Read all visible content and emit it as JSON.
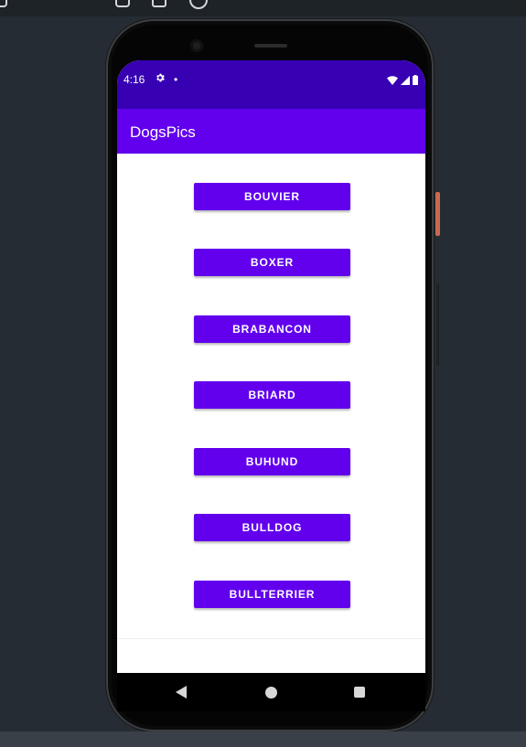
{
  "status_bar": {
    "time": "4:16",
    "settings_icon": "gear-icon",
    "notification_dot": "•",
    "wifi_icon": "wifi-icon",
    "signal_icon": "signal-icon",
    "battery_icon": "battery-icon"
  },
  "app_bar": {
    "title": "DogsPics"
  },
  "breeds": [
    {
      "label": "BOUVIER"
    },
    {
      "label": "BOXER"
    },
    {
      "label": "BRABANCON"
    },
    {
      "label": "BRIARD"
    },
    {
      "label": "BUHUND"
    },
    {
      "label": "BULLDOG"
    },
    {
      "label": "BULLTERRIER"
    }
  ],
  "nav_bar": {
    "back_icon": "back-icon",
    "home_icon": "home-icon",
    "recents_icon": "recents-icon"
  },
  "colors": {
    "status_bar": "#3700b3",
    "app_bar": "#6200ee",
    "button": "#6200ee"
  }
}
